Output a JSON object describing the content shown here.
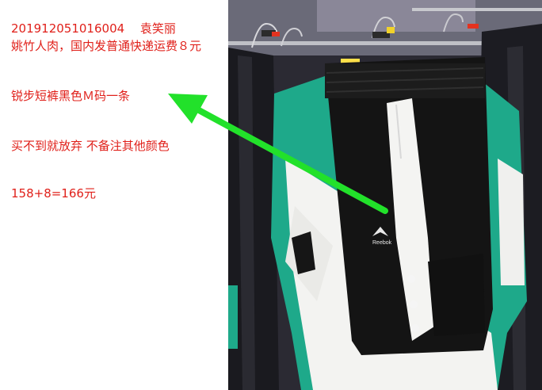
{
  "notes": {
    "order_line": "20191205101600",
    "order_suffix": "4　 袁笑丽",
    "shipping_line": "姚竹人肉，国内发普通快递运费８元",
    "item_line": "锐步短裤黑色Ｍ码一条",
    "remark_line": "买不到就放弃 不备注其他颜色",
    "price_line": "158+8=166元"
  },
  "photo": {
    "brand_logo_text": "Reebok"
  },
  "colors": {
    "note_text": "#e0201a",
    "arrow": "#22e12a",
    "shorts_black": "#141414",
    "shirt_green": "#1ea98a",
    "shirt_white": "#f3f3f1"
  }
}
